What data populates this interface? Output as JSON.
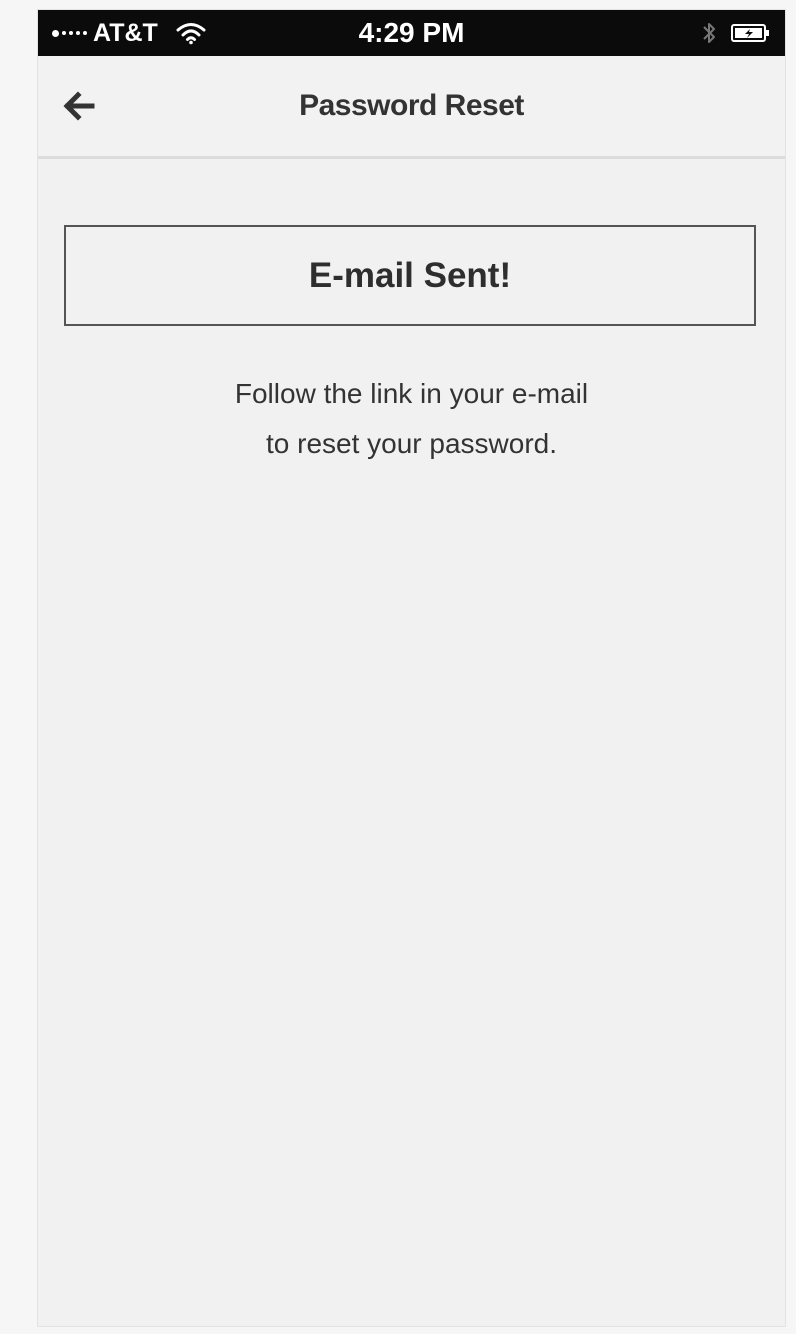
{
  "status_bar": {
    "carrier": "AT&T",
    "time": "4:29 PM",
    "wifi_icon": "wifi-icon",
    "bluetooth_icon": "bluetooth-icon",
    "battery_icon": "battery-charging-icon"
  },
  "navbar": {
    "back_icon": "arrow-left-icon",
    "title": "Password Reset"
  },
  "main": {
    "banner": "E-mail Sent!",
    "message_line1": "Follow the link in your e-mail",
    "message_line2": "to reset your password."
  },
  "colors": {
    "status_bar_bg": "#0b0b0b",
    "background": "#f1f1f1",
    "text": "#333333",
    "border": "#555555"
  }
}
